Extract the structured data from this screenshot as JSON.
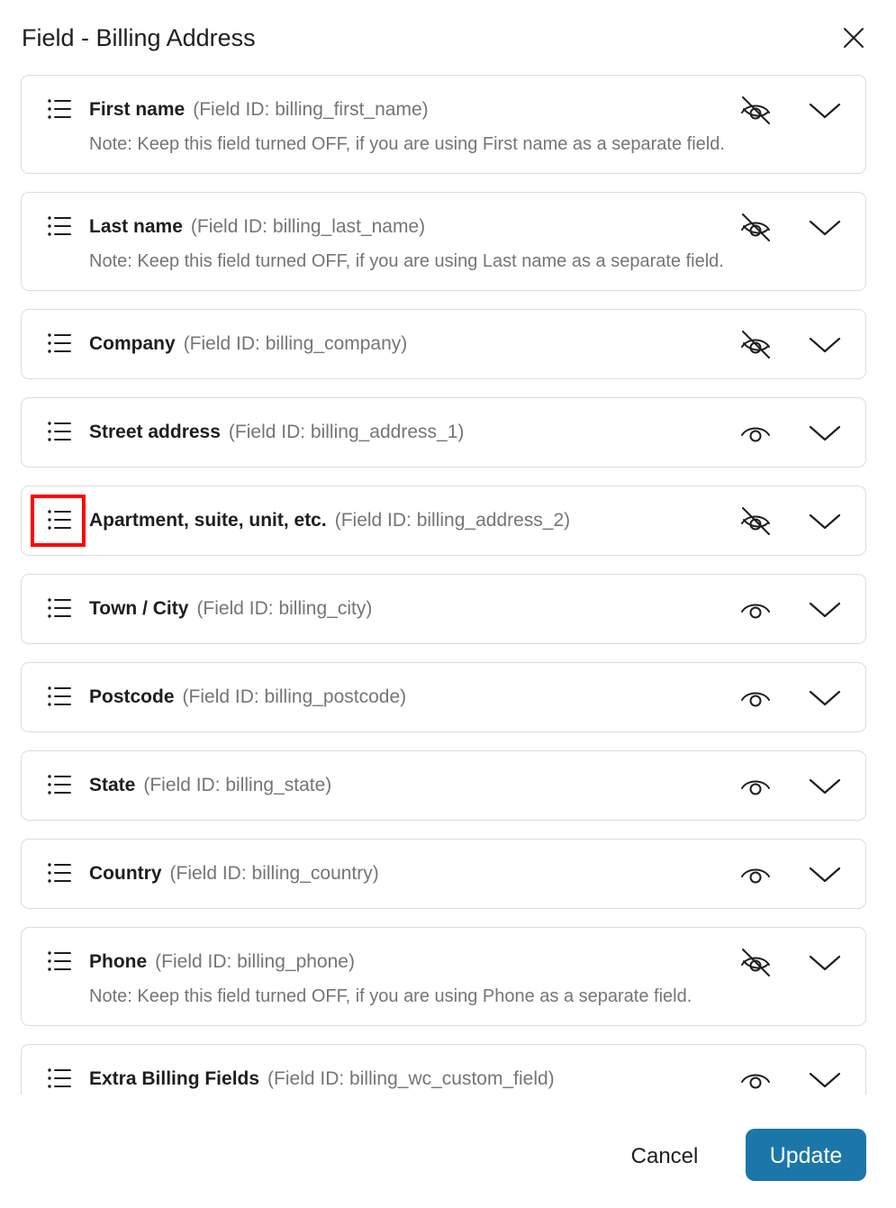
{
  "dialog": {
    "title": "Field - Billing Address",
    "cancel_label": "Cancel",
    "update_label": "Update",
    "accent_color": "#1b76a9"
  },
  "fields": [
    {
      "name": "First name",
      "field_id": "(Field ID: billing_first_name)",
      "visible": false,
      "note": "Note: Keep this field turned OFF, if you are using First name as a separate field."
    },
    {
      "name": "Last name",
      "field_id": "(Field ID: billing_last_name)",
      "visible": false,
      "note": "Note: Keep this field turned OFF, if you are using Last name as a separate field."
    },
    {
      "name": "Company",
      "field_id": "(Field ID: billing_company)",
      "visible": false
    },
    {
      "name": "Street address",
      "field_id": "(Field ID: billing_address_1)",
      "visible": true
    },
    {
      "name": "Apartment, suite, unit, etc.",
      "field_id": "(Field ID: billing_address_2)",
      "visible": false
    },
    {
      "name": "Town / City",
      "field_id": "(Field ID: billing_city)",
      "visible": true
    },
    {
      "name": "Postcode",
      "field_id": "(Field ID: billing_postcode)",
      "visible": true
    },
    {
      "name": "State",
      "field_id": "(Field ID: billing_state)",
      "visible": true
    },
    {
      "name": "Country",
      "field_id": "(Field ID: billing_country)",
      "visible": true
    },
    {
      "name": "Phone",
      "field_id": "(Field ID: billing_phone)",
      "visible": false,
      "note": "Note: Keep this field turned OFF, if you are using Phone as a separate field."
    },
    {
      "name": "Extra Billing Fields",
      "field_id": "(Field ID: billing_wc_custom_field)",
      "visible": true
    }
  ],
  "icons": {
    "drag": "drag-handle-icon",
    "visible": "eye-icon",
    "hidden": "eye-slash-icon",
    "expand": "chevron-down-icon",
    "close": "close-icon"
  }
}
